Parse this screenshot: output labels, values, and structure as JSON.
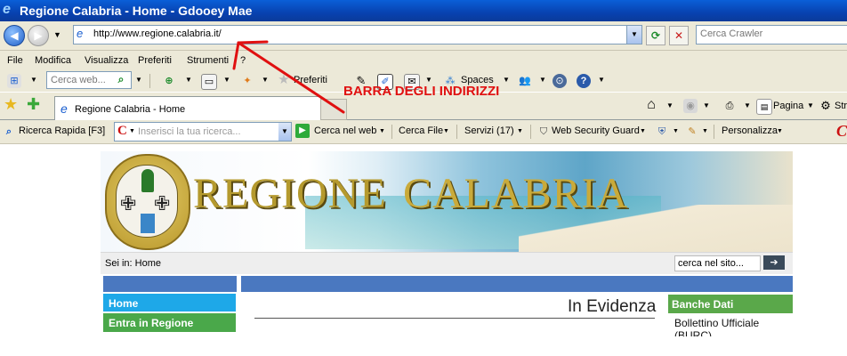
{
  "window": {
    "title": "Regione Calabria - Home - Gdooey Mae"
  },
  "address_bar": {
    "url": "http://www.regione.calabria.it/",
    "search_placeholder": "Cerca Crawler"
  },
  "menu": [
    "File",
    "Modifica",
    "Visualizza",
    "Preferiti",
    "Strumenti",
    "?"
  ],
  "toolbar2": {
    "search_placeholder": "Cerca web...",
    "preferiti": "Preferiti",
    "spaces": "Spaces"
  },
  "tabs": {
    "active_tab": "Regione Calabria - Home",
    "pagina": "Pagina",
    "strumenti_cut": "Str"
  },
  "addon_bar": {
    "ricerca_rapida": "Ricerca Rapida [F3]",
    "search_placeholder": "Inserisci la tua ricerca...",
    "cerca_nel_web": "Cerca nel web",
    "cerca_file": "Cerca File",
    "servizi": "Servizi (17)",
    "web_security_guard": "Web Security Guard",
    "personalizza": "Personalizza"
  },
  "annotation": {
    "label": "BARRA DEGLI INDIRIZZI",
    "color": "#e01010"
  },
  "page": {
    "banner_title_1": "REGIONE",
    "banner_title_2": "CALABRIA",
    "breadcrumb": "Sei in: Home",
    "site_search_placeholder": "cerca nel sito...",
    "site_search_button": "➔",
    "nav": [
      "Home",
      "Entra in Regione"
    ],
    "in_evidenza": "In Evidenza",
    "banche_dati": "Banche Dati",
    "bollettino": "Bollettino Ufficiale (BURC)"
  },
  "colors": {
    "title_bar": "#0842b0",
    "nav_blue": "#4a78c0",
    "home_blue": "#1ea8e8",
    "green": "#4aa84a"
  }
}
